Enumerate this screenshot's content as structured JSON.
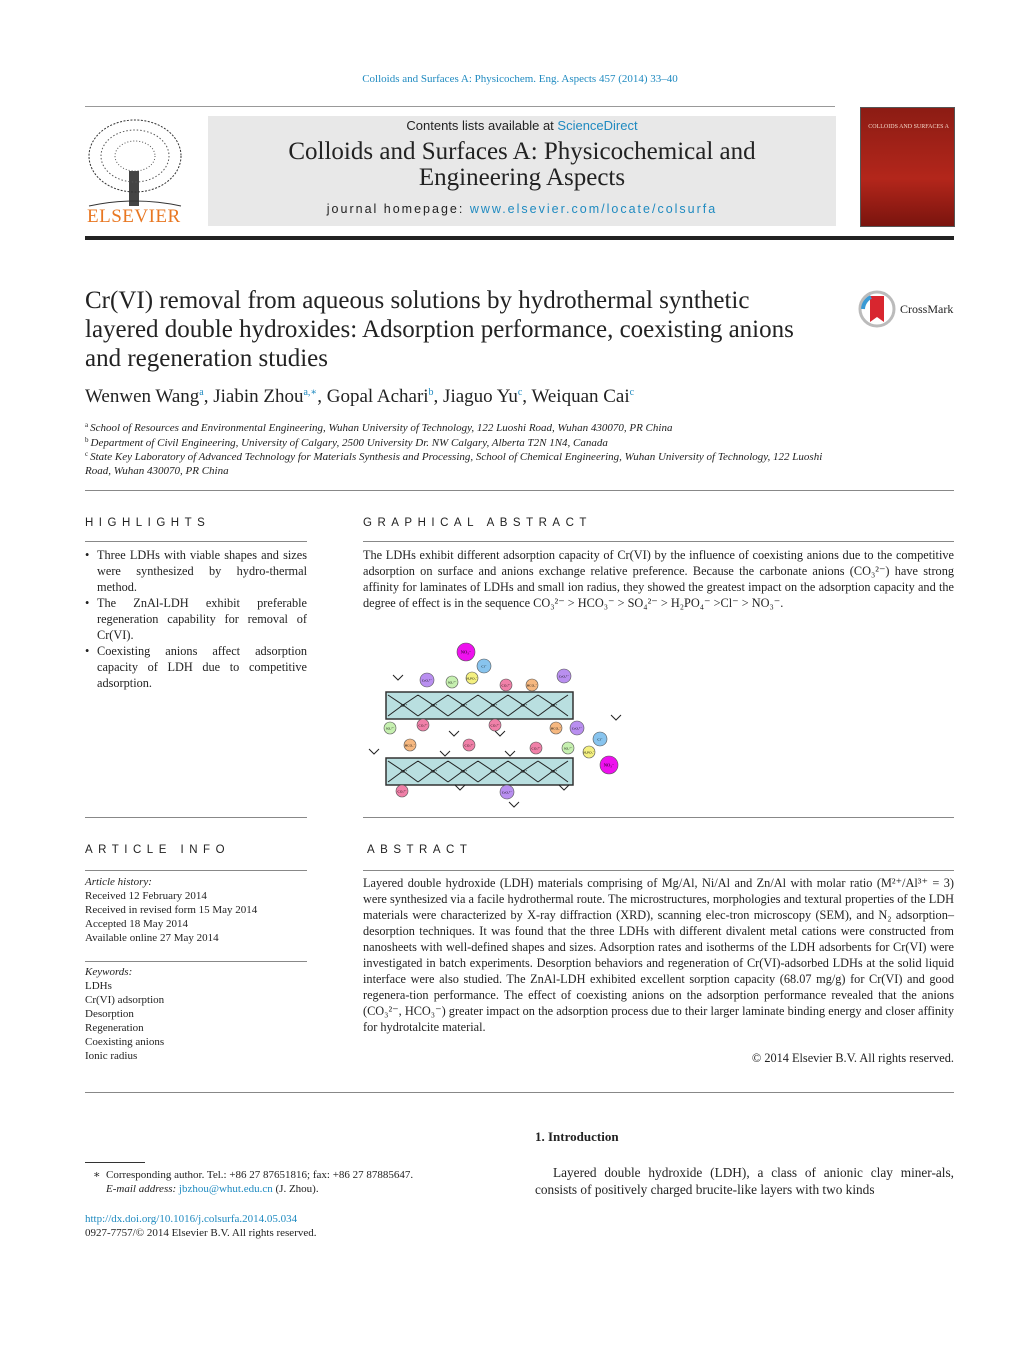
{
  "header": {
    "journal_ref": "Colloids and Surfaces A: Physicochem. Eng. Aspects 457 (2014) 33–40",
    "contents_prefix": "Contents lists available at ",
    "contents_link": "ScienceDirect",
    "journal_title": "Colloids and Surfaces A: Physicochemical and Engineering Aspects",
    "homepage_prefix": "journal homepage: ",
    "homepage_link": "www.elsevier.com/locate/colsurfa",
    "publisher_logo": "ELSEVIER",
    "cover_text": "COLLOIDS AND SURFACES A",
    "accent_color": "#1f8ac0",
    "logo_color": "#e87722"
  },
  "article": {
    "title": "Cr(VI) removal from aqueous solutions by hydrothermal synthetic layered double hydroxides: Adsorption performance, coexisting anions and regeneration studies",
    "crossmark": "CrossMark",
    "authors": [
      {
        "name": "Wenwen Wang",
        "sup": "a"
      },
      {
        "name": "Jiabin Zhou",
        "sup": "a,∗"
      },
      {
        "name": "Gopal Achari",
        "sup": "b"
      },
      {
        "name": "Jiaguo Yu",
        "sup": "c"
      },
      {
        "name": "Weiquan Cai",
        "sup": "c"
      }
    ],
    "affiliations": [
      {
        "key": "a",
        "text": "School of Resources and Environmental Engineering, Wuhan University of Technology, 122 Luoshi Road, Wuhan 430070, PR China"
      },
      {
        "key": "b",
        "text": "Department of Civil Engineering, University of Calgary, 2500 University Dr. NW Calgary, Alberta T2N 1N4, Canada"
      },
      {
        "key": "c",
        "text": "State Key Laboratory of Advanced Technology for Materials Synthesis and Processing, School of Chemical Engineering, Wuhan University of Technology, 122 Luoshi Road, Wuhan 430070, PR China"
      }
    ]
  },
  "highlights": {
    "heading": "HIGHLIGHTS",
    "items": [
      "Three LDHs with viable shapes and sizes were synthesized by hydro-thermal method.",
      "The ZnAl-LDH exhibit preferable regeneration capability for removal of Cr(VI).",
      "Coexisting anions affect adsorption capacity of LDH due to competitive adsorption."
    ]
  },
  "graphical_abstract": {
    "heading": "GRAPHICAL ABSTRACT",
    "text": "The LDHs exhibit different adsorption capacity of Cr(VI) by the influence of coexisting anions due to the competitive adsorption on surface and anions exchange relative preference. Because the carbonate anions (CO₃²⁻) have strong affinity for laminates of LDHs and small ion radius, they showed the greatest impact on the adsorption capacity and the degree of effect is in the sequence CO₃²⁻ > HCO₃⁻ > SO₄²⁻ > H₂PO₄⁻ >Cl⁻ > NO₃⁻.",
    "figure": {
      "layer_label": "Al³⁺",
      "layer_color": "#b9dfe0",
      "ions": {
        "NO3": {
          "label": "NO₃⁻",
          "color": "#ee11ee"
        },
        "Cl": {
          "label": "Cl⁻",
          "color": "#88c4ee"
        },
        "CrO4": {
          "label": "CrO₄²⁻",
          "color": "#b98ff0"
        },
        "SO4": {
          "label": "SO₄²⁻",
          "color": "#c6f0b0"
        },
        "H2PO4": {
          "label": "H₂PO₄⁻",
          "color": "#f4f080"
        },
        "CO3": {
          "label": "CO₃²⁻",
          "color": "#f080a8"
        },
        "HCO3": {
          "label": "HCO₃⁻",
          "color": "#f6b880"
        }
      }
    }
  },
  "article_info": {
    "heading": "ARTICLE INFO",
    "history_label": "Article history:",
    "history": [
      "Received 12 February 2014",
      "Received in revised form 15 May 2014",
      "Accepted 18 May 2014",
      "Available online 27 May 2014"
    ],
    "keywords_label": "Keywords:",
    "keywords": [
      "LDHs",
      "Cr(VI) adsorption",
      "Desorption",
      "Regeneration",
      "Coexisting anions",
      "Ionic radius"
    ]
  },
  "abstract": {
    "heading": "ABSTRACT",
    "text": "Layered double hydroxide (LDH) materials comprising of Mg/Al, Ni/Al and Zn/Al with molar ratio (M²⁺/Al³⁺ = 3) were synthesized via a facile hydrothermal route. The microstructures, morphologies and textural properties of the LDH materials were characterized by X-ray diffraction (XRD), scanning elec-tron microscopy (SEM), and N₂ adsorption–desorption techniques. It was found that the three LDHs with different divalent metal cations were constructed from nanosheets with well-defined shapes and sizes. Adsorption rates and isotherms of the LDH adsorbents for Cr(VI) were investigated in batch experiments. Desorption behaviors and regeneration of Cr(VI)-adsorbed LDHs at the solid liquid interface were also studied. The ZnAl-LDH exhibited excellent sorption capacity (68.07 mg/g) for Cr(VI) and good regenera-tion performance. The effect of coexisting anions on the adsorption performance revealed that the anions (CO₃²⁻, HCO₃⁻) greater impact on the adsorption process due to their larger laminate binding energy and closer affinity for hydrotalcite material.",
    "copyright": "© 2014 Elsevier B.V. All rights reserved."
  },
  "introduction": {
    "heading": "1.  Introduction",
    "text": "Layered double hydroxide (LDH), a class of anionic clay miner-als, consists of positively charged brucite-like layers with two kinds"
  },
  "footnote": {
    "star": "∗",
    "corresponding": "Corresponding author. Tel.: +86 27 87651816; fax: +86 27 87885647.",
    "email_label": "E-mail address:",
    "email": "jbzhou@whut.edu.cn",
    "email_suffix": " (J. Zhou).",
    "doi": "http://dx.doi.org/10.1016/j.colsurfa.2014.05.034",
    "issn": "0927-7757/© 2014 Elsevier B.V. All rights reserved."
  }
}
